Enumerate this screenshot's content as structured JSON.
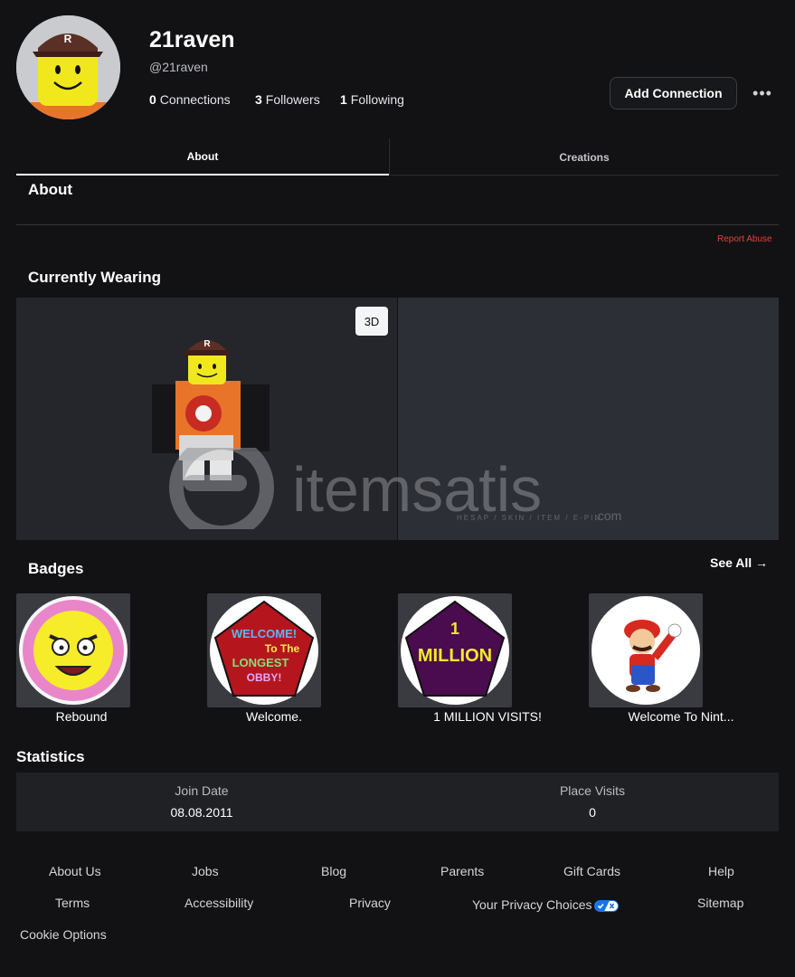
{
  "profile": {
    "display_name": "21raven",
    "username": "@21raven",
    "connections_count": "0",
    "connections_label": "Connections",
    "followers_count": "3",
    "followers_label": "Followers",
    "following_count": "1",
    "following_label": "Following",
    "add_connection_label": "Add Connection",
    "more_label": "•••"
  },
  "tabs": [
    {
      "label": "About",
      "active": true
    },
    {
      "label": "Creations",
      "active": false
    }
  ],
  "about": {
    "heading": "About",
    "report_abuse": "Report Abuse"
  },
  "wearing": {
    "heading": "Currently Wearing",
    "view_3d_label": "3D"
  },
  "watermark": {
    "brand": "itemsatis",
    "tagline": "HESAP / SKIN / ITEM / E-PIN",
    "suffix": ".com"
  },
  "badges": {
    "heading": "Badges",
    "see_all": "See All →",
    "items": [
      {
        "label": "Rebound"
      },
      {
        "label": "Welcome."
      },
      {
        "label": "1 MILLION VISITS!"
      },
      {
        "label": "Welcome To Nint..."
      }
    ],
    "welcome_art": [
      "WELCOME!",
      "To The",
      "LONGEST",
      "OBBY!"
    ],
    "million_art": [
      "1",
      "MILLION"
    ]
  },
  "statistics": {
    "heading": "Statistics",
    "join_date_label": "Join Date",
    "join_date_value": "08.08.2011",
    "place_visits_label": "Place Visits",
    "place_visits_value": "0"
  },
  "footer": {
    "row1": [
      "About Us",
      "Jobs",
      "Blog",
      "Parents",
      "Gift Cards",
      "Help"
    ],
    "row2": [
      "Terms",
      "Accessibility",
      "Privacy",
      "Your Privacy Choices",
      "Sitemap"
    ],
    "row3": [
      "Cookie Options"
    ]
  },
  "colors": {
    "background": "#121215",
    "accent_report": "#e0433a",
    "privacy_toggle": "#1a73e8"
  }
}
